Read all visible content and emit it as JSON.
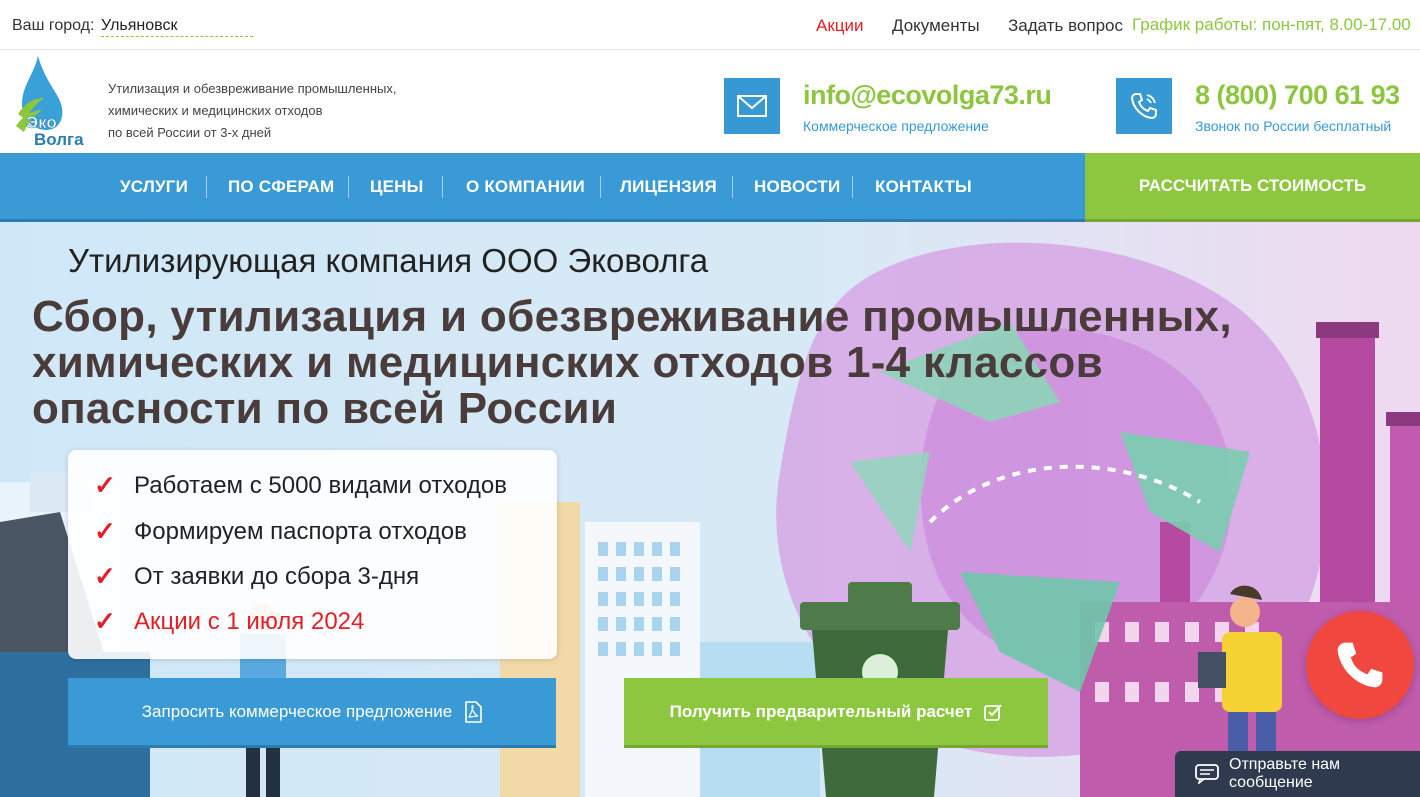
{
  "topbar": {
    "city_label": "Ваш город:",
    "city_value": "Ульяновск",
    "links": {
      "promo": "Акции",
      "documents": "Документы",
      "ask": "Задать вопрос"
    },
    "schedule": "График работы: пон-пят, 8.00-17.00"
  },
  "header": {
    "logo_text": {
      "line1": "Эко",
      "line2": "Волга"
    },
    "tagline": [
      "Утилизация и обезвреживание промышленных,",
      "химических и медицинских отходов",
      "по всей России от 3-х дней"
    ],
    "email": {
      "address": "info@ecovolga73.ru",
      "subtitle": "Коммерческое предложение",
      "icon": "envelope-icon"
    },
    "phone": {
      "number": "8 (800) 700 61 93",
      "subtitle": "Звонок по России бесплатный",
      "icon": "phone-icon"
    }
  },
  "nav": {
    "items": [
      "УСЛУГИ",
      "ПО СФЕРАМ",
      "ЦЕНЫ",
      "О КОМПАНИИ",
      "ЛИЦЕНЗИЯ",
      "НОВОСТИ",
      "КОНТАКТЫ"
    ],
    "calc_button": "РАССЧИТАТЬ СТОИМОСТЬ"
  },
  "hero": {
    "kicker": "Утилизирующая компания ООО Эковолга",
    "title_lines": [
      "Сбор, утилизация и обезвреживание промышленных,",
      "химических и медицинских отходов 1-4 классов",
      "опасности по всей России"
    ],
    "features": [
      "Работаем с 5000 видами отходов",
      "Формируем паспорта отходов",
      "От заявки до сбора 3-дня",
      "Акции с 1 июля 2024"
    ],
    "cta_primary": "Запросить коммерческое предложение",
    "cta_secondary": "Получить предварительный расчет"
  },
  "widgets": {
    "chat_label": "Отправьте нам сообщение"
  },
  "colors": {
    "blue": "#3a9ad6",
    "green": "#8dc63f",
    "red": "#e31e24",
    "dark": "#2f3a4f"
  }
}
